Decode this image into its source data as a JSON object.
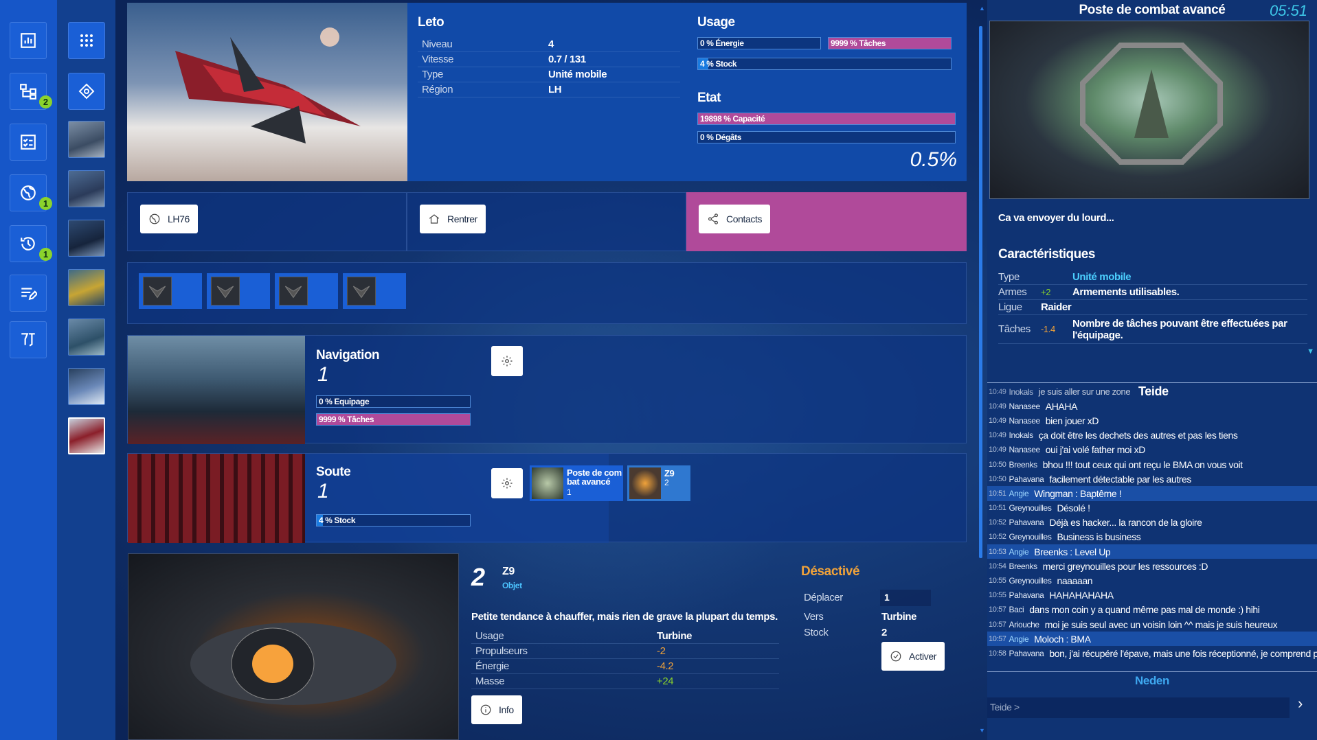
{
  "ship": {
    "name": "Leto",
    "stats": [
      {
        "label": "Niveau",
        "value": "4"
      },
      {
        "label": "Vitesse",
        "value": "0.7 / 131"
      },
      {
        "label": "Type",
        "value": "Unité mobile"
      },
      {
        "label": "Région",
        "value": "LH"
      }
    ],
    "usage_title": "Usage",
    "usage_bars": [
      {
        "label": "0 % Énergie",
        "fraction": 0.0
      },
      {
        "label": "9999 % Tâches",
        "fraction": 1.0
      },
      {
        "label": "4 % Stock",
        "fraction": 0.04
      }
    ],
    "state_title": "Etat",
    "state_bars": [
      {
        "label": "19898 % Capacité",
        "fraction": 1.0
      },
      {
        "label": "0 % Dégâts",
        "fraction": 0.0
      }
    ],
    "state_percent": "0.5%"
  },
  "actions": {
    "location_label": "LH76",
    "return_label": "Rentrer",
    "contacts_label": "Contacts"
  },
  "navigation": {
    "title": "Navigation",
    "count": "1",
    "bars": [
      {
        "label": "0 % Equipage",
        "fraction": 0.0
      },
      {
        "label": "9999 % Tâches",
        "fraction": 1.0
      }
    ]
  },
  "hold": {
    "title": "Soute",
    "count": "1",
    "bar": {
      "label": "4 % Stock",
      "fraction": 0.04
    },
    "items": [
      {
        "name": "Poste de com bat avancé",
        "qty": "1"
      },
      {
        "name": "Z9",
        "qty": "2"
      }
    ]
  },
  "item_detail": {
    "qty": "2",
    "name": "Z9",
    "kind": "Objet",
    "description": "Petite tendance à chauffer, mais rien de grave la plupart du temps.",
    "props": [
      {
        "label": "Usage",
        "value": "Turbine"
      },
      {
        "label": "Propulseurs",
        "value": "-2"
      },
      {
        "label": "Énergie",
        "value": "-4.2"
      },
      {
        "label": "Masse",
        "value": "+24"
      }
    ],
    "info_label": "Info",
    "status": "Désactivé",
    "move_label": "Déplacer",
    "move_value": "1",
    "to_label": "Vers",
    "to_value": "Turbine",
    "stock_label": "Stock",
    "stock_value": "2",
    "activate_label": "Activer"
  },
  "right": {
    "title": "Poste de combat avancé",
    "clock": "05:51",
    "caption": "Ca va envoyer du lourd...",
    "char_title": "Caractéristiques",
    "chars": [
      {
        "label": "Type",
        "mod": "",
        "value": "Unité mobile"
      },
      {
        "label": "Armes",
        "mod": "+2",
        "value": "Armements utilisables."
      },
      {
        "label": "Ligue",
        "mod": "",
        "value": "Raider"
      },
      {
        "label": "Tâches",
        "mod": "-1.4",
        "value": "Nombre de tâches pouvant être effectuées par l'équipage."
      }
    ],
    "chat_channel": "Teide",
    "chat_channel_2": "Neden",
    "chat_input_placeholder": "Teide >",
    "chat": [
      {
        "time": "10:49",
        "nick": "Inokals",
        "msg": "je suis aller sur une zone",
        "hl": false
      },
      {
        "time": "10:49",
        "nick": "Nanasee",
        "msg": "AHAHA",
        "hl": false
      },
      {
        "time": "10:49",
        "nick": "Nanasee",
        "msg": "bien jouer xD",
        "hl": false
      },
      {
        "time": "10:49",
        "nick": "Inokals",
        "msg": "ça doit être les dechets des autres et pas les tiens",
        "hl": false
      },
      {
        "time": "10:49",
        "nick": "Nanasee",
        "msg": "oui j'ai volé father moi xD",
        "hl": false
      },
      {
        "time": "10:50",
        "nick": "Breenks",
        "msg": "bhou !!! tout ceux qui ont reçu le BMA on vous voit",
        "hl": false
      },
      {
        "time": "10:50",
        "nick": "Pahavana",
        "msg": "facilement détectable par les autres",
        "hl": false
      },
      {
        "time": "10:51",
        "nick": "Angie",
        "msg": "Wingman : Baptême !",
        "hl": true
      },
      {
        "time": "10:51",
        "nick": "Greynouilles",
        "msg": "Désolé !",
        "hl": false
      },
      {
        "time": "10:52",
        "nick": "Pahavana",
        "msg": "Déjà es hacker... la rancon de la gloire",
        "hl": false
      },
      {
        "time": "10:52",
        "nick": "Greynouilles",
        "msg": "Business is business",
        "hl": false
      },
      {
        "time": "10:53",
        "nick": "Angie",
        "msg": "Breenks : Level Up",
        "hl": true
      },
      {
        "time": "10:54",
        "nick": "Breenks",
        "msg": "merci greynouilles pour les ressources :D",
        "hl": false
      },
      {
        "time": "10:55",
        "nick": "Greynouilles",
        "msg": "naaaaan",
        "hl": false
      },
      {
        "time": "10:55",
        "nick": "Pahavana",
        "msg": "HAHAHAHAHA",
        "hl": false
      },
      {
        "time": "10:57",
        "nick": "Baci",
        "msg": "dans mon coin y a quand même pas mal de monde :) hihi",
        "hl": false
      },
      {
        "time": "10:57",
        "nick": "Ariouche",
        "msg": "moi je suis seul avec un voisin loin ^^ mais je suis heureux",
        "hl": false
      },
      {
        "time": "10:57",
        "nick": "Angie",
        "msg": "Moloch : BMA",
        "hl": true
      },
      {
        "time": "10:58",
        "nick": "Pahavana",
        "msg": "bon, j'ai récupéré l'épave, mais une fois réceptionné, je comprend pa",
        "hl": false
      }
    ]
  },
  "badges": {
    "tree": "2",
    "globe": "1",
    "history": "1"
  },
  "colors": {
    "accent": "#1a5fd6",
    "magenta": "#b04a9a",
    "gold": "#f0a23a",
    "green": "#8bd32c"
  }
}
